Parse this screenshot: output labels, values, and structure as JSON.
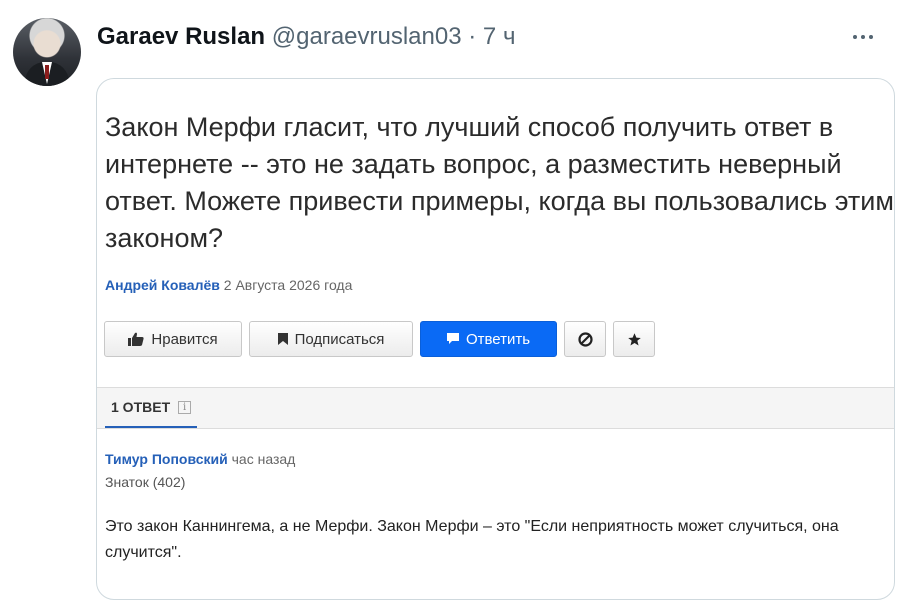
{
  "tweet": {
    "display_name": "Garaev Ruslan",
    "handle": "@garaevruslan03",
    "separator": "·",
    "time": "7 ч"
  },
  "question": {
    "text": "Закон Мерфи гласит, что лучший способ получить ответ в интернете -- это не задать вопрос, а разместить неверный ответ. Можете привести примеры, когда вы пользовались этим законом?",
    "author": "Андрей Ковалёв",
    "date": "2 Августа 2026 года"
  },
  "actions": {
    "like_label": "Нравится",
    "subscribe_label": "Подписаться",
    "reply_label": "Ответить"
  },
  "answers_tab": {
    "label": "1 ОТВЕТ"
  },
  "answer": {
    "author": "Тимур Поповский",
    "time": "час назад",
    "rank": "Знаток (402)",
    "text": "Это закон Каннингема, а не Мерфи. Закон Мерфи – это \"Если неприятность может случиться, она случится\"."
  },
  "icons": {
    "like": "thumbs-up-icon",
    "subscribe": "bookmark-icon",
    "reply": "comment-icon",
    "block": "block-icon",
    "favorite": "star-icon",
    "more": "more-icon",
    "info": "info-icon"
  },
  "colors": {
    "link_blue": "#2560b8",
    "primary_button": "#0a6af5",
    "muted_text": "#536471"
  }
}
